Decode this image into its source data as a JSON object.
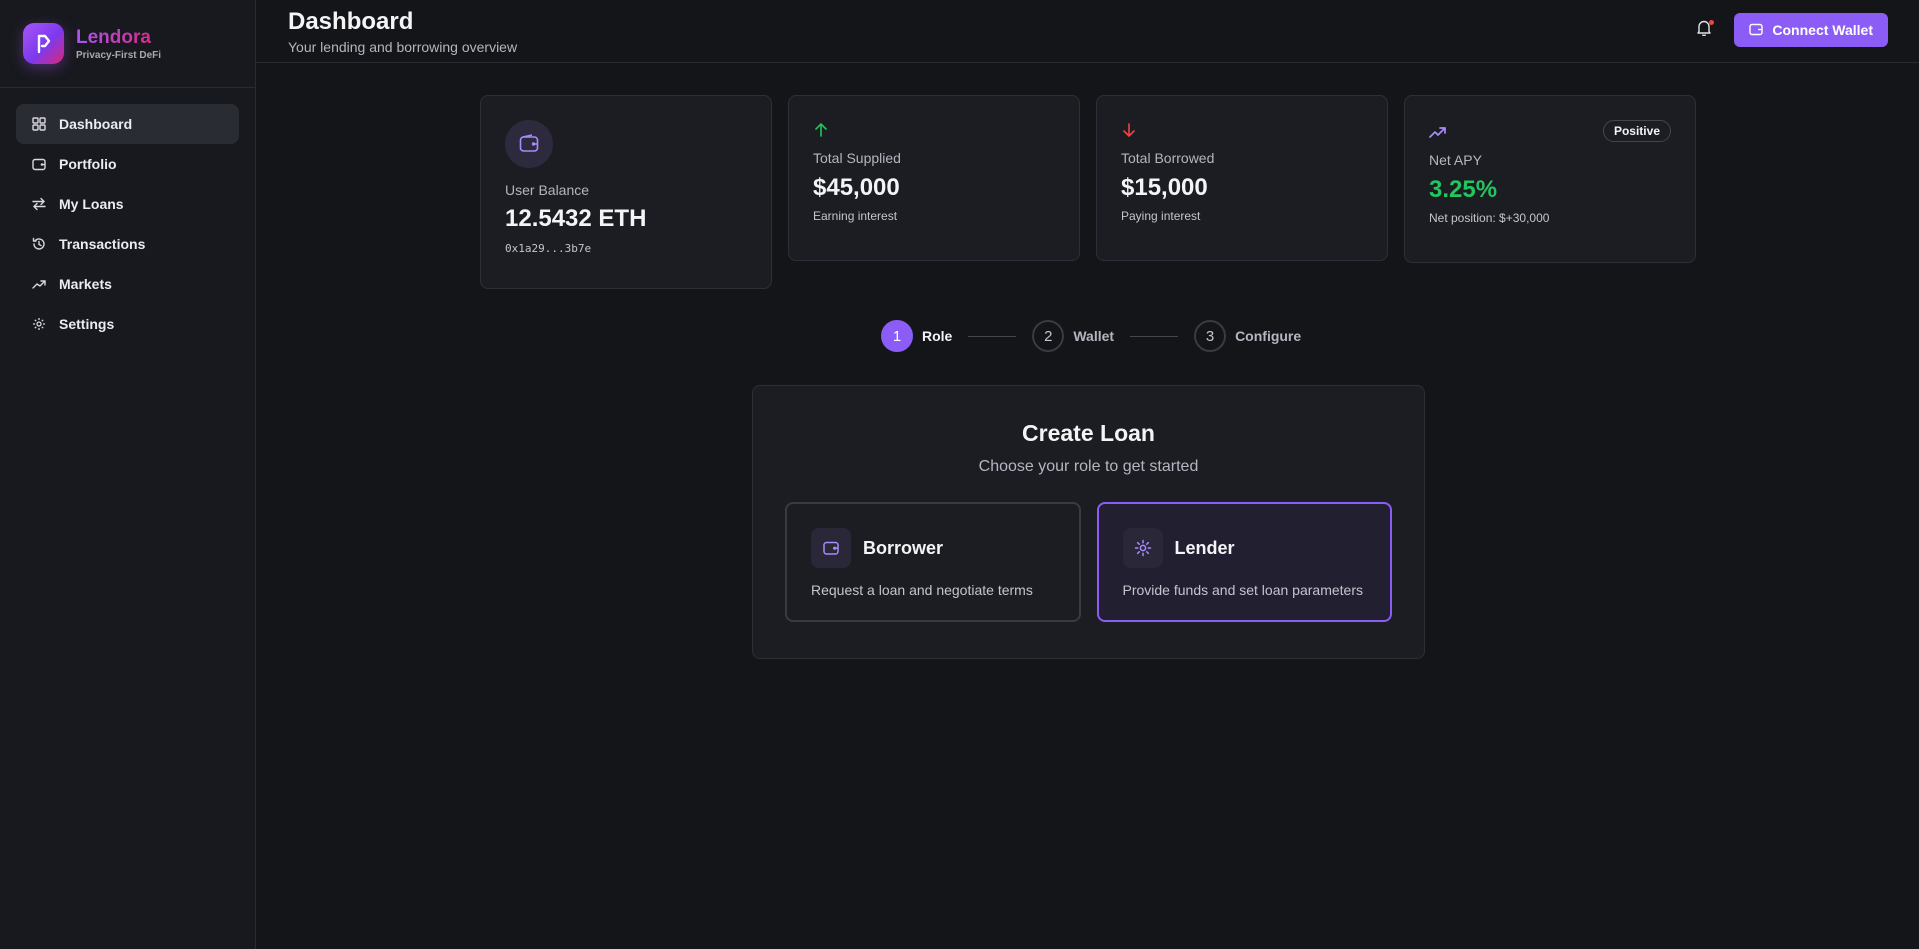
{
  "brand": {
    "name": "Lendora",
    "tagline": "Privacy-First DeFi"
  },
  "sidebar": {
    "items": [
      {
        "label": "Dashboard",
        "icon": "grid-icon",
        "active": true
      },
      {
        "label": "Portfolio",
        "icon": "wallet-icon"
      },
      {
        "label": "My Loans",
        "icon": "arrows-swap-icon"
      },
      {
        "label": "Transactions",
        "icon": "history-icon"
      },
      {
        "label": "Markets",
        "icon": "trending-up-icon"
      },
      {
        "label": "Settings",
        "icon": "gear-icon"
      }
    ]
  },
  "header": {
    "title": "Dashboard",
    "subtitle": "Your lending and borrowing overview",
    "connect_label": "Connect Wallet"
  },
  "stats": {
    "balance": {
      "label": "User Balance",
      "value": "12.5432 ETH",
      "address": "0x1a29...3b7e"
    },
    "supplied": {
      "label": "Total Supplied",
      "value": "$45,000",
      "note": "Earning interest"
    },
    "borrowed": {
      "label": "Total Borrowed",
      "value": "$15,000",
      "note": "Paying interest"
    },
    "apy": {
      "label": "Net APY",
      "value": "3.25%",
      "note": "Net position: $+30,000",
      "badge": "Positive"
    }
  },
  "stepper": {
    "steps": [
      {
        "num": "1",
        "label": "Role",
        "active": true
      },
      {
        "num": "2",
        "label": "Wallet"
      },
      {
        "num": "3",
        "label": "Configure"
      }
    ]
  },
  "create_loan": {
    "title": "Create Loan",
    "subtitle": "Choose your role to get started",
    "borrower": {
      "title": "Borrower",
      "desc": "Request a loan and negotiate terms"
    },
    "lender": {
      "title": "Lender",
      "desc": "Provide funds and set loan parameters"
    }
  },
  "colors": {
    "accent": "#8b5cf6",
    "positive": "#22c55e",
    "negative": "#ef4444",
    "background": "#141519"
  }
}
